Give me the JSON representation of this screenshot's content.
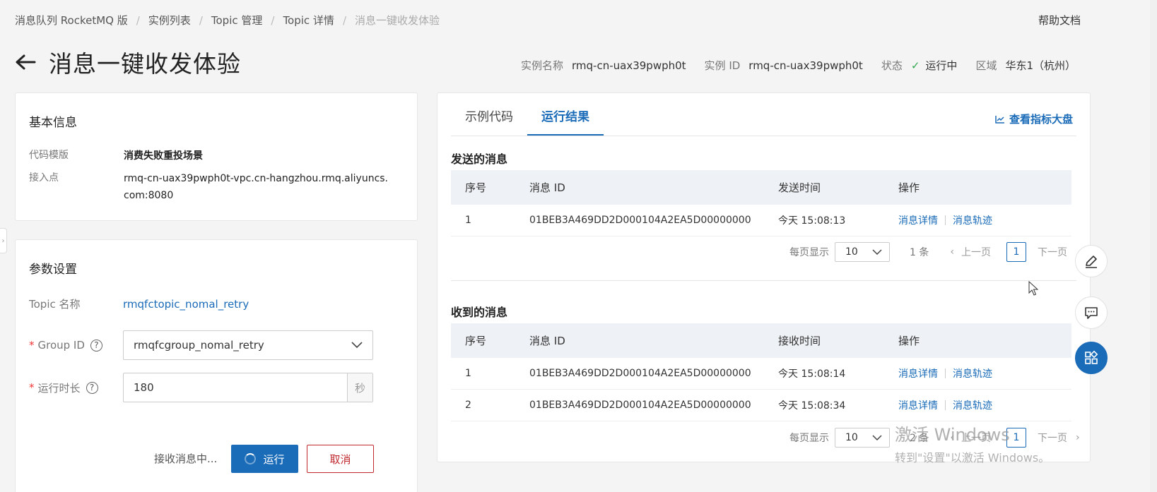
{
  "breadcrumb": {
    "items": [
      "消息队列 RocketMQ 版",
      "实例列表",
      "Topic 管理",
      "Topic 详情"
    ],
    "current": "消息一键收发体验"
  },
  "header": {
    "help": "帮助文档",
    "title": "消息一键收发体验",
    "instance_name_label": "实例名称",
    "instance_name": "rmq-cn-uax39pwph0t",
    "instance_id_label": "实例 ID",
    "instance_id": "rmq-cn-uax39pwph0t",
    "status_label": "状态",
    "status": "运行中",
    "region_label": "区域",
    "region": "华东1（杭州）"
  },
  "basic_info": {
    "title": "基本信息",
    "template_label": "代码模版",
    "template_value": "消费失败重投场景",
    "endpoint_label": "接入点",
    "endpoint_value": "rmq-cn-uax39pwph0t-vpc.cn-hangzhou.rmq.aliyuncs.com:8080"
  },
  "params": {
    "title": "参数设置",
    "topic_label": "Topic 名称",
    "topic_value": "rmqfctopic_nomal_retry",
    "group_label": "Group ID",
    "group_value": "rmqfcgroup_nomal_retry",
    "duration_label": "运行时长",
    "duration_value": "180",
    "duration_unit": "秒",
    "receiving_text": "接收消息中...",
    "run_label": "运行",
    "cancel_label": "取消"
  },
  "results": {
    "tabs": [
      "示例代码",
      "运行结果"
    ],
    "dashboard_link": "查看指标大盘",
    "sent": {
      "title": "发送的消息",
      "columns": [
        "序号",
        "消息 ID",
        "发送时间",
        "操作"
      ],
      "rows": [
        {
          "no": "1",
          "id": "01BEB3A469DD2D000104A2EA5D00000000",
          "time": "今天 15:08:13",
          "detail": "消息详情",
          "trace": "消息轨迹"
        }
      ],
      "pager": {
        "per_page_label": "每页显示",
        "per_page": "10",
        "count": "1 条",
        "prev": "上一页",
        "page": "1",
        "next": "下一页"
      }
    },
    "received": {
      "title": "收到的消息",
      "columns": [
        "序号",
        "消息 ID",
        "接收时间",
        "操作"
      ],
      "rows": [
        {
          "no": "1",
          "id": "01BEB3A469DD2D000104A2EA5D00000000",
          "time": "今天 15:08:14",
          "detail": "消息详情",
          "trace": "消息轨迹"
        },
        {
          "no": "2",
          "id": "01BEB3A469DD2D000104A2EA5D00000000",
          "time": "今天 15:08:34",
          "detail": "消息详情",
          "trace": "消息轨迹"
        }
      ],
      "pager": {
        "per_page_label": "每页显示",
        "per_page": "10",
        "count": "2 条",
        "prev": "上一页",
        "page": "1",
        "next": "下一页"
      }
    }
  },
  "watermark": {
    "line1": "激活 Windows",
    "line2": "转到\"设置\"以激活 Windows。"
  }
}
